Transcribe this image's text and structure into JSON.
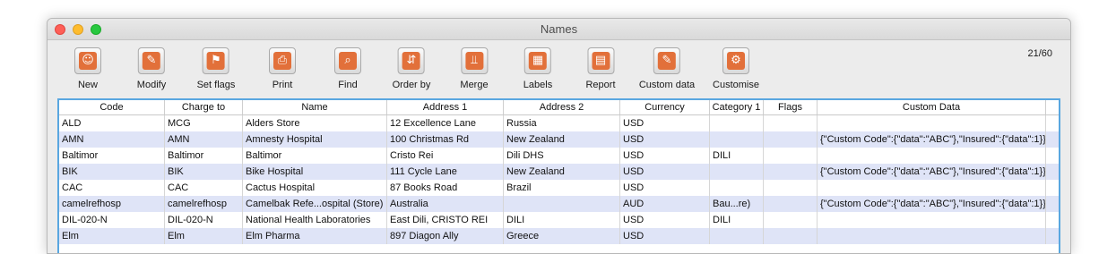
{
  "window": {
    "title": "Names"
  },
  "toolbar": {
    "buttons": [
      {
        "label": "New",
        "icon": "person-icon",
        "glyph": "☺"
      },
      {
        "label": "Modify",
        "icon": "edit-icon",
        "glyph": "✎"
      },
      {
        "label": "Set flags",
        "icon": "flag-icon",
        "glyph": "⚑"
      },
      {
        "label": "Print",
        "icon": "printer-icon",
        "glyph": "⎙"
      },
      {
        "label": "Find",
        "icon": "magnifier-icon",
        "glyph": "⌕"
      },
      {
        "label": "Order by",
        "icon": "sort-icon",
        "glyph": "⇵"
      },
      {
        "label": "Merge",
        "icon": "merge-icon",
        "glyph": "⫫"
      },
      {
        "label": "Labels",
        "icon": "labels-grid-icon",
        "glyph": "▦"
      },
      {
        "label": "Report",
        "icon": "report-cards-icon",
        "glyph": "▤"
      },
      {
        "label": "Custom data",
        "icon": "custom-data-icon",
        "glyph": "✎"
      },
      {
        "label": "Customise",
        "icon": "gear-icon",
        "glyph": "⚙"
      }
    ],
    "record_count": "21/60"
  },
  "table": {
    "columns": [
      "Code",
      "Charge to",
      "Name",
      "Address 1",
      "Address 2",
      "Currency",
      "Category 1",
      "Flags",
      "Custom Data"
    ],
    "rows": [
      [
        "ALD",
        "MCG",
        "Alders Store",
        "12 Excellence Lane",
        "Russia",
        "USD",
        "",
        "",
        ""
      ],
      [
        "AMN",
        "AMN",
        "Amnesty Hospital",
        "100 Christmas Rd",
        "New Zealand",
        "USD",
        "",
        "",
        "{\"Custom Code\":{\"data\":\"ABC\"},\"Insured\":{\"data\":1}}"
      ],
      [
        "Baltimor",
        "Baltimor",
        "Baltimor",
        "Cristo Rei",
        "Dili DHS",
        "USD",
        "DILI",
        "",
        ""
      ],
      [
        "BIK",
        "BIK",
        "Bike Hospital",
        "111 Cycle Lane",
        "New Zealand",
        "USD",
        "",
        "",
        "{\"Custom Code\":{\"data\":\"ABC\"},\"Insured\":{\"data\":1}}"
      ],
      [
        "CAC",
        "CAC",
        "Cactus Hospital",
        "87 Books Road",
        "Brazil",
        "USD",
        "",
        "",
        ""
      ],
      [
        "camelrefhosp",
        "camelrefhosp",
        "Camelbak Refe...ospital (Store)",
        "Australia",
        "",
        "AUD",
        "Bau...re)",
        "",
        "{\"Custom Code\":{\"data\":\"ABC\"},\"Insured\":{\"data\":1}}"
      ],
      [
        "DIL-020-N",
        "DIL-020-N",
        "National Health Laboratories",
        "East Dili, CRISTO REI",
        "DILI",
        "USD",
        "DILI",
        "",
        ""
      ],
      [
        "Elm",
        "Elm",
        "Elm Pharma",
        "897 Diagon Ally",
        "Greece",
        "USD",
        "",
        "",
        ""
      ]
    ]
  },
  "colors": {
    "accent_border": "#59a7e0",
    "alt_row": "#dfe4f7",
    "icon_orange": "#e2703a"
  }
}
